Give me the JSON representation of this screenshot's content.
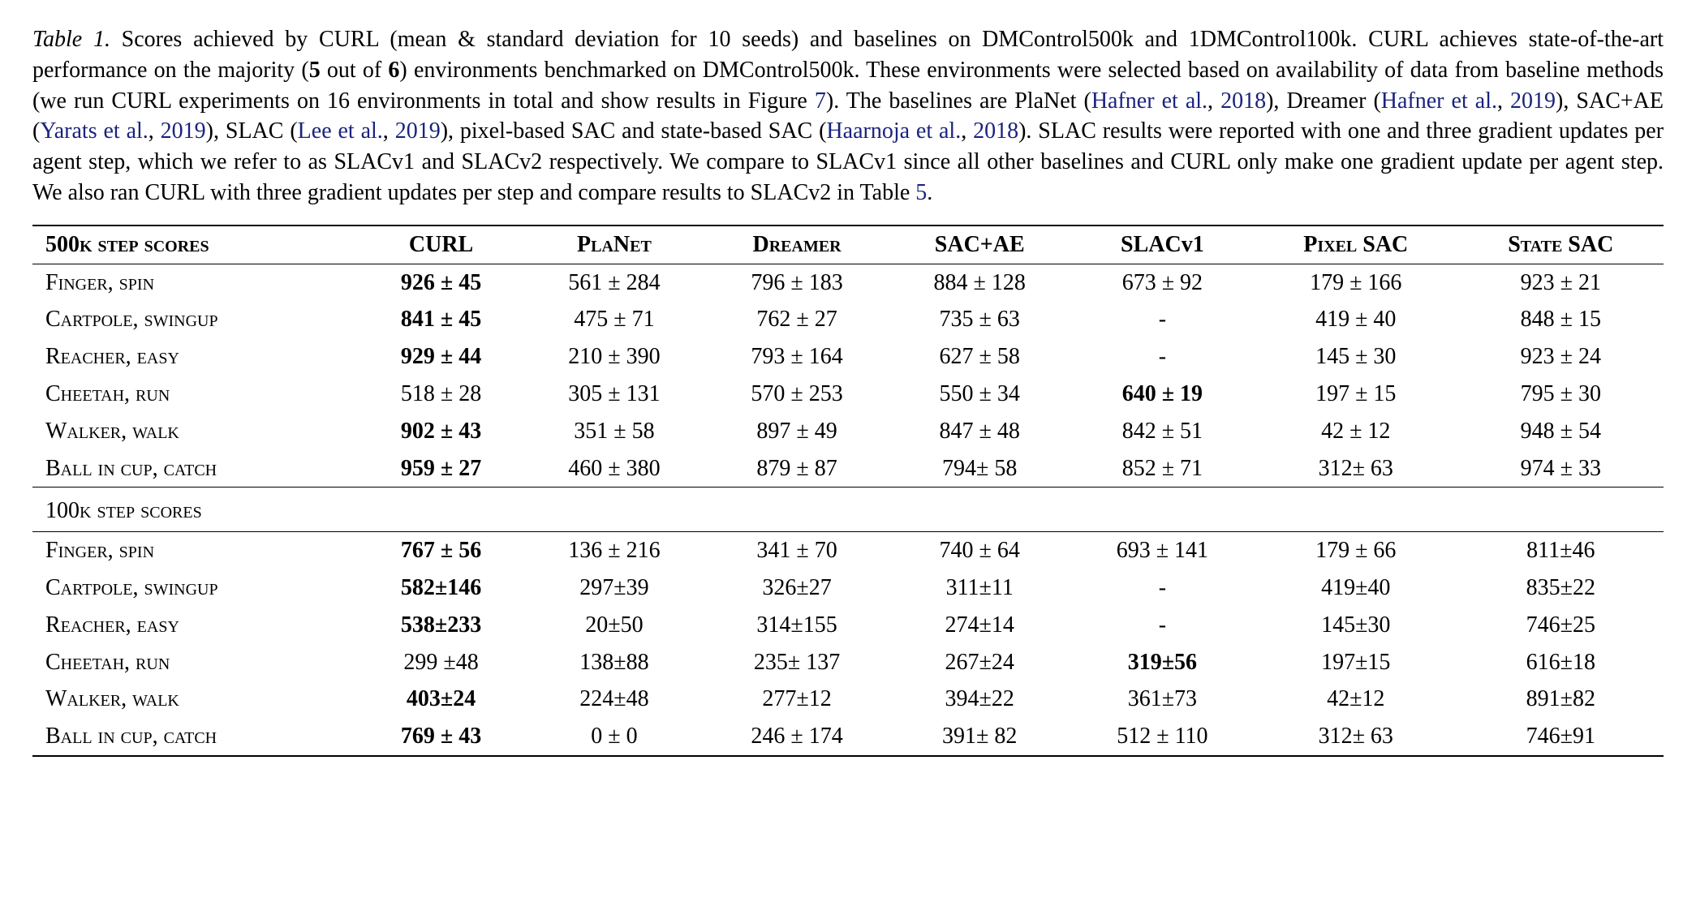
{
  "caption": {
    "label": "Table 1.",
    "p1": " Scores achieved by CURL (mean & standard deviation for 10 seeds) and baselines on DMControl500k and 1DMControl100k. CURL achieves state-of-the-art performance on the majority (",
    "bold1": "5",
    "mid1": " out of ",
    "bold2": "6",
    "p2": ") environments benchmarked on DMControl500k. These environments were selected based on availability of data from baseline methods (we run CURL experiments on 16 environments in total and show results in Figure ",
    "figref": "7",
    "p3": "). The baselines are PlaNet (",
    "cite1a": "Hafner et al.",
    "cite1b": "2018",
    "p4": "), Dreamer (",
    "cite2a": "Hafner et al.",
    "cite2b": "2019",
    "p5": "), SAC+AE (",
    "cite3a": "Yarats et al.",
    "cite3b": "2019",
    "p6": "), SLAC (",
    "cite4a": "Lee et al.",
    "cite4b": "2019",
    "p7": "), pixel-based SAC and state-based SAC (",
    "cite5a": "Haarnoja et al.",
    "cite5b": "2018",
    "p8": "). SLAC results were reported with one and three gradient updates per agent step, which we refer to as SLACv1 and SLACv2 respectively. We compare to SLACv1 since all other baselines and CURL only make one gradient update per agent step. We also ran CURL with three gradient updates per step and compare results to SLACv2 in Table ",
    "tblref": "5",
    "p9": "."
  },
  "headers": {
    "rowlabel500": "500k step scores",
    "rowlabel100": "100k step scores",
    "c1": "CURL",
    "c2": "PlaNet",
    "c3": "Dreamer",
    "c4": "SAC+AE",
    "c5": "SLACv1",
    "c6": "Pixel SAC",
    "c7": "State SAC"
  },
  "envs": {
    "finger": "Finger, spin",
    "cartpole": "Cartpole, swingup",
    "reacher": "Reacher, easy",
    "cheetah": "Cheetah, run",
    "walker": "Walker, walk",
    "ball": "Ball in cup, catch"
  },
  "chart_data": {
    "type": "table",
    "columns": [
      "CURL",
      "PlaNet",
      "Dreamer",
      "SAC+AE",
      "SLACv1",
      "Pixel SAC",
      "State SAC"
    ],
    "sections": [
      {
        "title": "500K STEP SCORES",
        "rows": [
          {
            "env": "Finger, spin",
            "cells": [
              "926 ± 45",
              "561 ± 284",
              "796 ± 183",
              "884 ± 128",
              "673 ± 92",
              "179 ± 166",
              "923 ± 21"
            ],
            "bold_idx": 0
          },
          {
            "env": "Cartpole, swingup",
            "cells": [
              "841 ± 45",
              "475 ± 71",
              "762 ± 27",
              "735 ± 63",
              "-",
              "419 ± 40",
              "848 ± 15"
            ],
            "bold_idx": 0
          },
          {
            "env": "Reacher, easy",
            "cells": [
              "929 ± 44",
              "210 ± 390",
              "793 ± 164",
              "627 ± 58",
              "-",
              "145 ± 30",
              "923 ± 24"
            ],
            "bold_idx": 0
          },
          {
            "env": "Cheetah, run",
            "cells": [
              "518 ± 28",
              "305 ± 131",
              "570 ± 253",
              "550 ± 34",
              "640 ± 19",
              "197 ± 15",
              "795 ± 30"
            ],
            "bold_idx": 4
          },
          {
            "env": "Walker, walk",
            "cells": [
              "902 ± 43",
              "351 ± 58",
              "897 ± 49",
              "847 ± 48",
              "842 ± 51",
              "42 ± 12",
              "948 ± 54"
            ],
            "bold_idx": 0
          },
          {
            "env": "Ball in cup, catch",
            "cells": [
              "959 ± 27",
              "460 ± 380",
              "879 ± 87",
              "794± 58",
              "852 ± 71",
              "312± 63",
              "974 ± 33"
            ],
            "bold_idx": 0
          }
        ]
      },
      {
        "title": "100K STEP SCORES",
        "rows": [
          {
            "env": "Finger, spin",
            "cells": [
              "767 ± 56",
              "136 ± 216",
              "341 ± 70",
              "740 ± 64",
              "693 ± 141",
              "179 ± 66",
              "811±46"
            ],
            "bold_idx": 0
          },
          {
            "env": "Cartpole, swingup",
            "cells": [
              "582±146",
              "297±39",
              "326±27",
              "311±11",
              "-",
              "419±40",
              "835±22"
            ],
            "bold_idx": 0
          },
          {
            "env": "Reacher, easy",
            "cells": [
              "538±233",
              "20±50",
              "314±155",
              "274±14",
              "-",
              "145±30",
              "746±25"
            ],
            "bold_idx": 0
          },
          {
            "env": "Cheetah, run",
            "cells": [
              "299 ±48",
              "138±88",
              "235± 137",
              "267±24",
              "319±56",
              "197±15",
              "616±18"
            ],
            "bold_idx": 4
          },
          {
            "env": "Walker, walk",
            "cells": [
              "403±24",
              "224±48",
              "277±12",
              "394±22",
              "361±73",
              "42±12",
              "891±82"
            ],
            "bold_idx": 0
          },
          {
            "env": "Ball in cup, catch",
            "cells": [
              "769 ± 43",
              "0 ± 0",
              "246 ± 174",
              "391± 82",
              "512 ± 110",
              "312± 63",
              "746±91"
            ],
            "bold_idx": 0
          }
        ]
      }
    ]
  }
}
